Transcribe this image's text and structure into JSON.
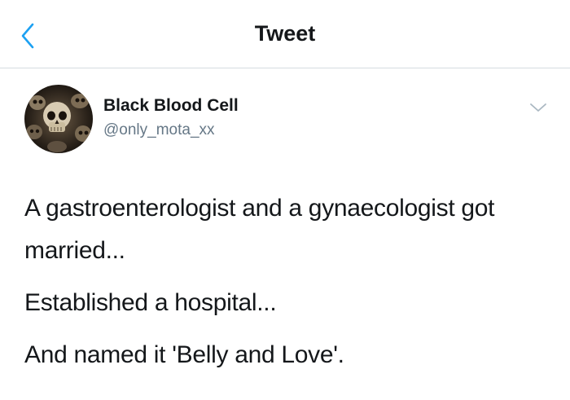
{
  "header": {
    "title": "Tweet",
    "back_icon": "chevron-left-icon",
    "accent_color": "#1da1f2"
  },
  "tweet": {
    "author": {
      "name": "Black Blood Cell",
      "handle": "@only_mota_xx",
      "avatar_icon": "skull-avatar"
    },
    "menu_icon": "chevron-down-icon",
    "paragraphs": [
      "A gastroenterologist and a gynaecologist got married...",
      "Established a hospital...",
      "And named it 'Belly and Love'."
    ]
  }
}
